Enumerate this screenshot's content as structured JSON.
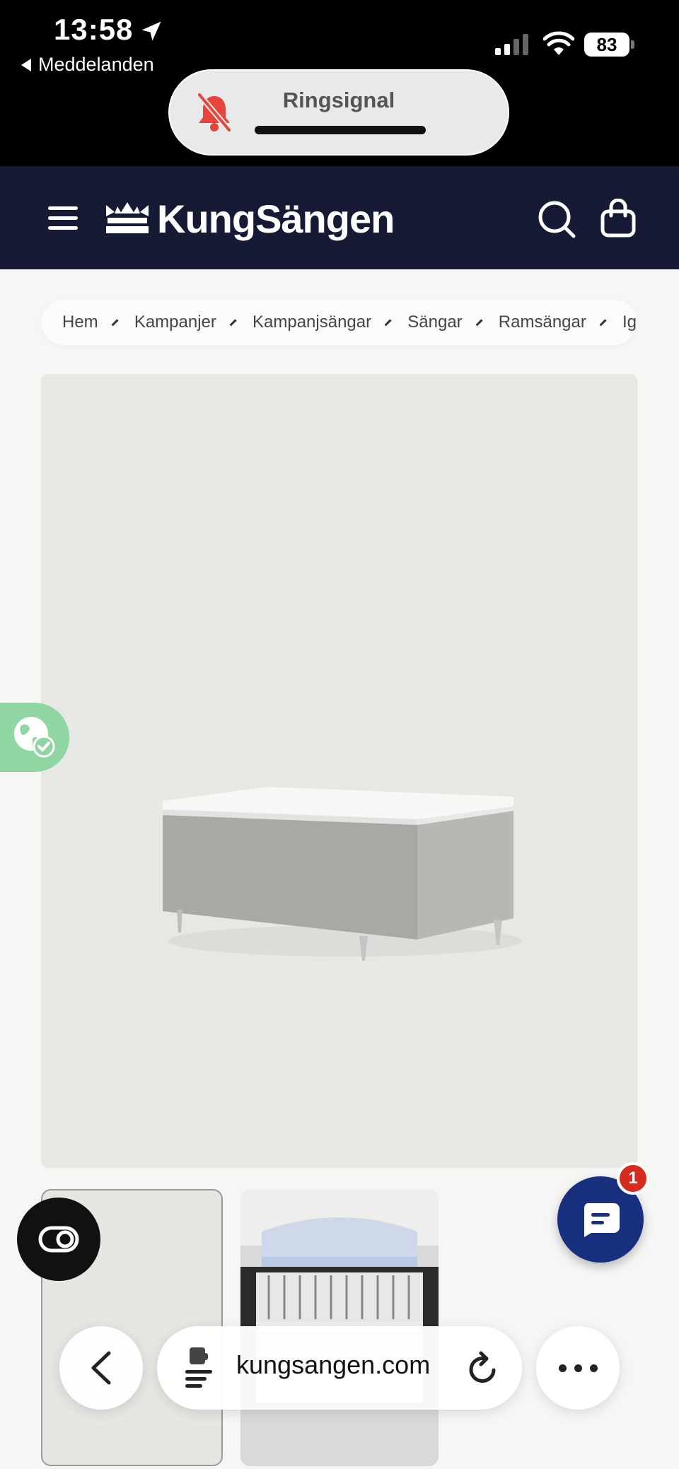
{
  "status_bar": {
    "time": "13:58",
    "back_app_label": "Meddelanden",
    "battery_percent": "83",
    "signal_bars_active": 2,
    "signal_bars_total": 4
  },
  "ring_indicator": {
    "label": "Ringsignal",
    "icon": "bell-slash-icon",
    "icon_color": "#e5453c"
  },
  "header": {
    "brand_name": "KungSängen",
    "background_color": "#171a35",
    "icons": [
      "hamburger-menu-icon",
      "crown-icon",
      "search-icon",
      "shopping-bag-icon"
    ]
  },
  "breadcrumb": {
    "items": [
      "Hem",
      "Kampanjer",
      "Kampanjsängar",
      "Sängar",
      "Ramsängar",
      "Ig"
    ]
  },
  "product": {
    "image_alt": "gray frame bed on metal legs",
    "thumbnails": [
      "bed-thumbnail",
      "pocket-spring-mattress-cross-section-thumbnail"
    ]
  },
  "floating": {
    "chat_badge_count": "1",
    "chat_color": "#172f7c",
    "accessibility_icon": "accessibility-toggle-icon",
    "consent_icon": "globe-check-icon",
    "consent_color": "#8fd6a3"
  },
  "browser": {
    "url": "kungsangen.com",
    "icons": [
      "back-chevron-icon",
      "reader-icon",
      "reload-icon",
      "more-icon"
    ]
  }
}
